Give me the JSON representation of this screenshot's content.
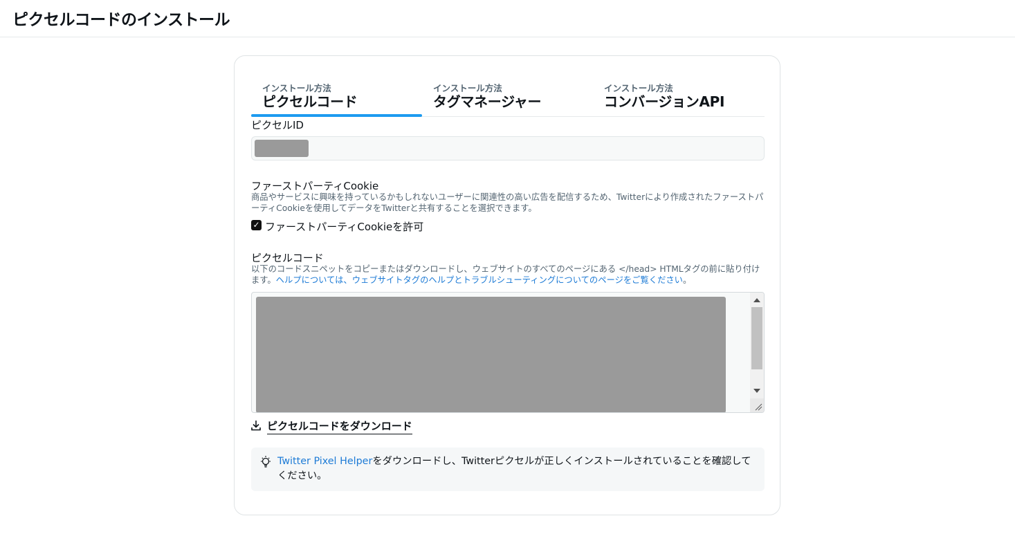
{
  "page": {
    "title": "ピクセルコードのインストール"
  },
  "tabs": [
    {
      "sub": "インストール方法",
      "label": "ピクセルコード",
      "active": true
    },
    {
      "sub": "インストール方法",
      "label": "タグマネージャー",
      "active": false
    },
    {
      "sub": "インストール方法",
      "label": "コンバージョンAPI",
      "active": false
    }
  ],
  "pixel_id": {
    "label": "ピクセルID"
  },
  "first_party_cookie": {
    "label": "ファーストパーティCookie",
    "description": "商品やサービスに興味を持っているかもしれないユーザーに関連性の高い広告を配信するため、Twitterにより作成されたファーストパーティCookieを使用してデータをTwitterと共有することを選択できます。",
    "checkbox_label": "ファーストパーティCookieを許可",
    "checked": true
  },
  "pixel_code": {
    "label": "ピクセルコード",
    "description": "以下のコードスニペットをコピーまたはダウンロードし、ウェブサイトのすべてのページにある </head> HTMLタグの前に貼り付けます。",
    "help_link": "ヘルプについては、ウェブサイトタグのヘルプとトラブルシューティングについてのページをご覧ください",
    "description_end": "。",
    "download_label": "ピクセルコードをダウンロード"
  },
  "info": {
    "link": "Twitter Pixel Helper",
    "text": "をダウンロードし、Twitterピクセルが正しくインストールされていることを確認してください。"
  },
  "colors": {
    "accent": "#1d9bf0",
    "link": "#1d7bd6",
    "redacted": "#9a9a9a"
  }
}
